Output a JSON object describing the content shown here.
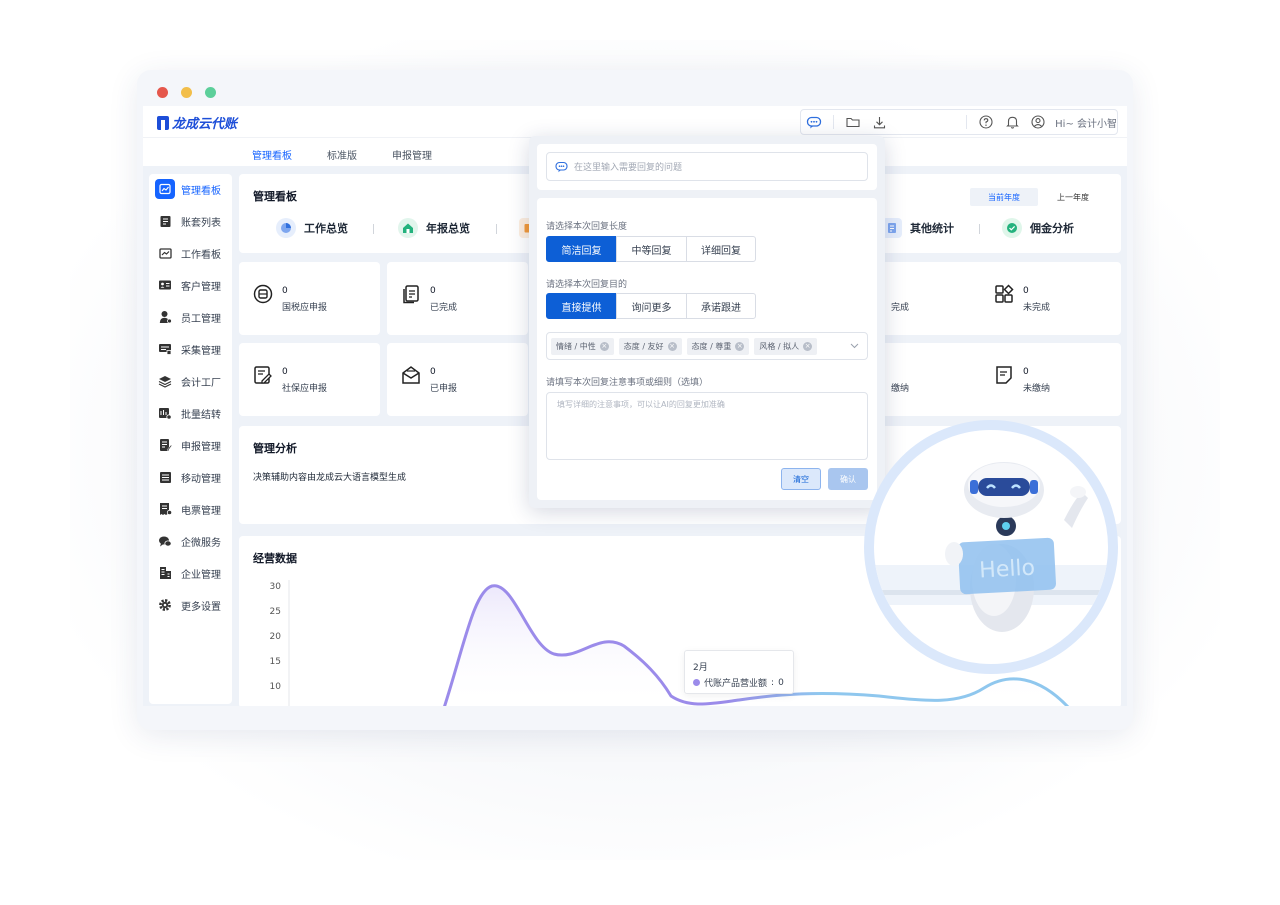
{
  "app": {
    "logo_text": "龙成云代账",
    "user_greeting": "Hi~ 会计小智"
  },
  "colors": {
    "primary": "#1664ff",
    "popup_primary": "#0d5fd6",
    "dot_red": "#e5574c",
    "dot_yellow": "#f2be4a",
    "dot_green": "#5ccf9a",
    "chart_purple": "#9b8bea",
    "chart_blue": "#8fc7ee"
  },
  "top_tabs": [
    "管理看板",
    "标准版",
    "申报管理"
  ],
  "sidebar": {
    "items": [
      {
        "label": "管理看板",
        "icon": "dashboard-icon"
      },
      {
        "label": "账套列表",
        "icon": "ledger-list-icon"
      },
      {
        "label": "工作看板",
        "icon": "work-board-icon"
      },
      {
        "label": "客户管理",
        "icon": "customer-card-icon"
      },
      {
        "label": "员工管理",
        "icon": "employee-icon"
      },
      {
        "label": "采集管理",
        "icon": "collect-icon"
      },
      {
        "label": "会计工厂",
        "icon": "layers-icon"
      },
      {
        "label": "批量结转",
        "icon": "batch-transfer-icon"
      },
      {
        "label": "申报管理",
        "icon": "declare-icon"
      },
      {
        "label": "移动管理",
        "icon": "mobile-list-icon"
      },
      {
        "label": "电票管理",
        "icon": "invoice-icon"
      },
      {
        "label": "企微服务",
        "icon": "chat-icon"
      },
      {
        "label": "企业管理",
        "icon": "building-icon"
      },
      {
        "label": "更多设置",
        "icon": "gear-icon"
      }
    ]
  },
  "overview": {
    "title": "管理看板",
    "year_current": "当前年度",
    "year_last": "上一年度",
    "items": [
      "工作总览",
      "年报总览",
      "其他统计",
      "佣金分析"
    ]
  },
  "stats": {
    "row1": [
      {
        "value": "0",
        "label": "国税应申报"
      },
      {
        "value": "0",
        "label": "已完成"
      },
      {
        "value": "",
        "label": "完成"
      },
      {
        "value": "0",
        "label": "未完成"
      }
    ],
    "row2": [
      {
        "value": "0",
        "label": "社保应申报"
      },
      {
        "value": "0",
        "label": "已申报"
      },
      {
        "value": "",
        "label": "缴纳"
      },
      {
        "value": "0",
        "label": "未缴纳"
      }
    ]
  },
  "analysis": {
    "title": "管理分析",
    "text": "决策辅助内容由龙成云大语言模型生成"
  },
  "operations": {
    "title": "经营数据"
  },
  "chart_data": {
    "type": "line",
    "title": "经营数据",
    "y_ticks": [
      30,
      25,
      20,
      15,
      10
    ],
    "ylim": [
      0,
      30
    ],
    "series": [
      {
        "name": "代账产品营业额",
        "color": "#9b8bea"
      }
    ],
    "tooltip": {
      "month": "2月",
      "series_name": "代账产品营业额",
      "value": "0"
    }
  },
  "popup": {
    "ask_placeholder": "在这里输入需要回复的问题",
    "length_label": "请选择本次回复长度",
    "length_options": [
      "简洁回复",
      "中等回复",
      "详细回复"
    ],
    "purpose_label": "请选择本次回复目的",
    "purpose_options": [
      "直接提供",
      "询问更多",
      "承诺跟进"
    ],
    "tags": [
      "情绪 / 中性",
      "态度 / 友好",
      "态度 / 尊重",
      "风格 / 拟人"
    ],
    "notes_label": "请填写本次回复注意事项或细则（选填）",
    "notes_placeholder": "填写详细的注意事项，可以让AI的回复更加准确",
    "clear_label": "清空",
    "confirm_label": "确认"
  },
  "robot": {
    "sign_text": "Hello"
  }
}
